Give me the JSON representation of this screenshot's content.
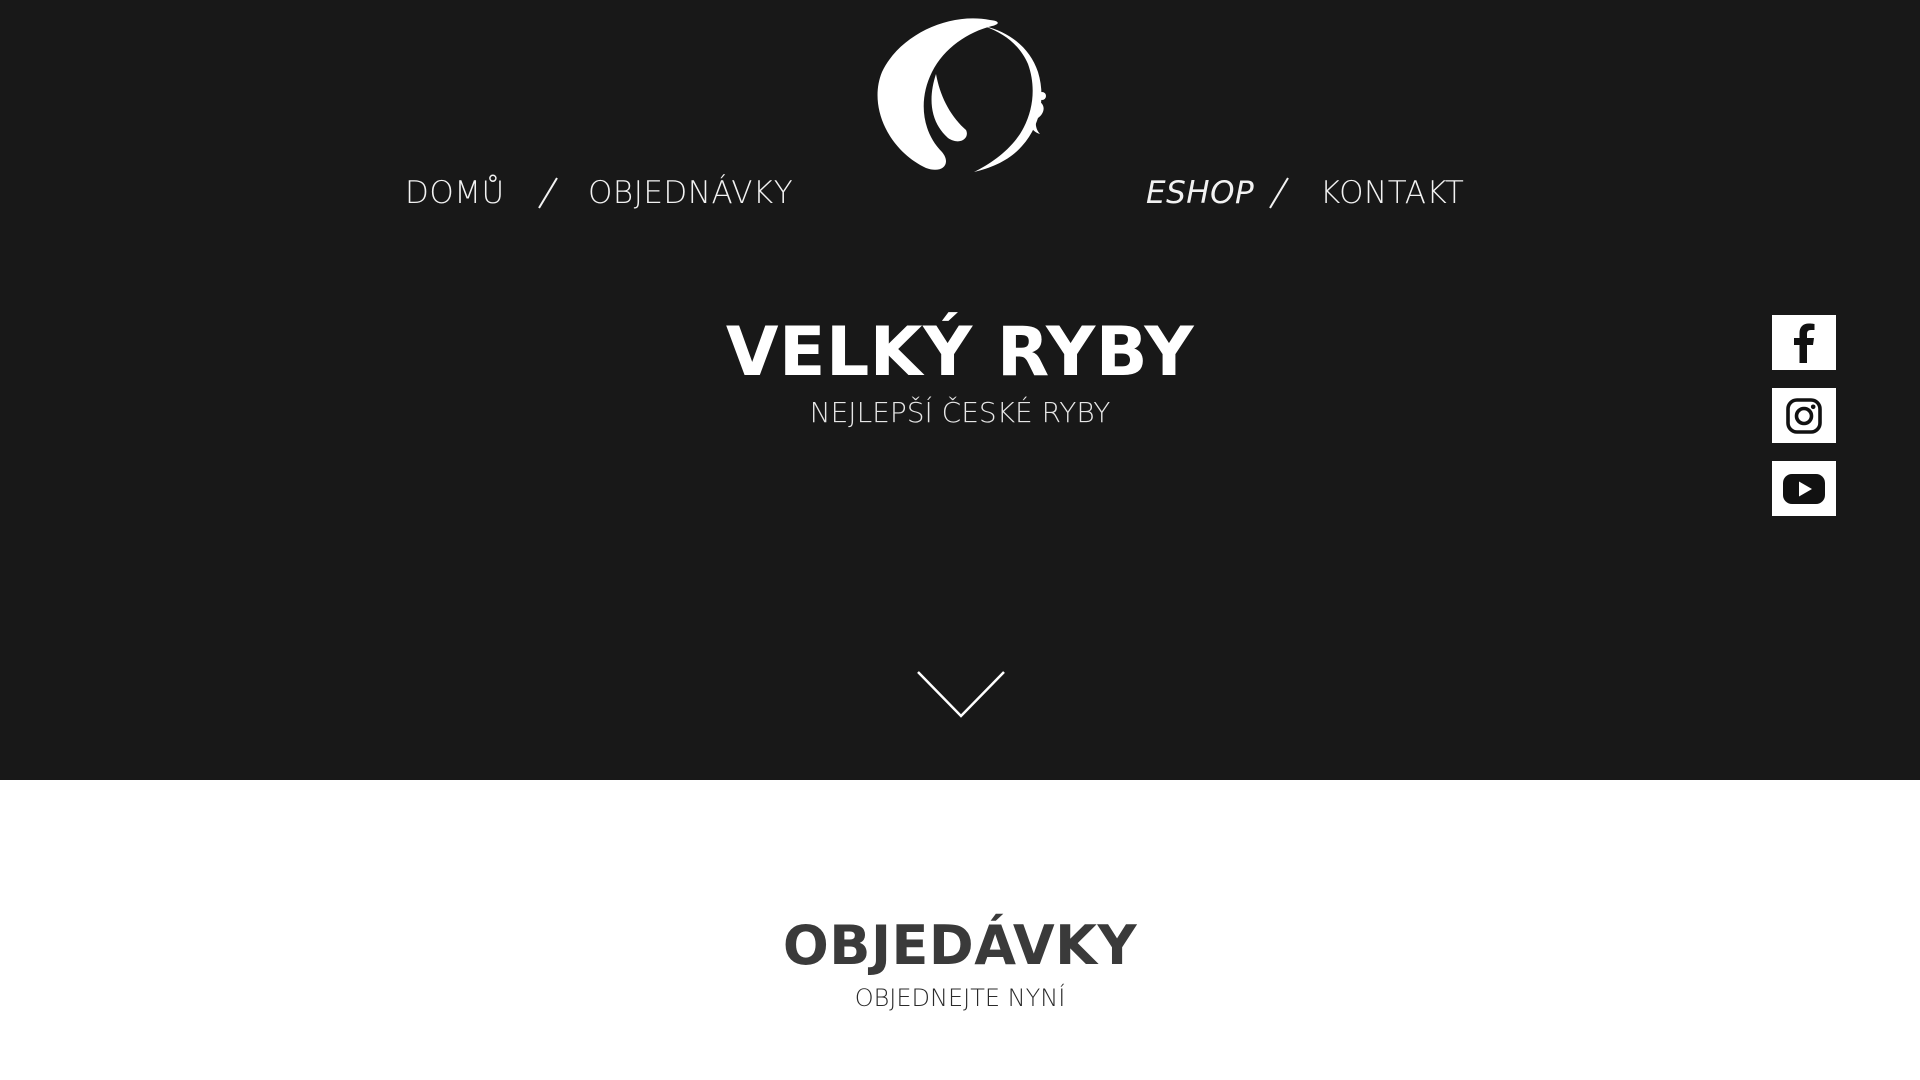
{
  "nav": {
    "home": "DOMŮ",
    "orders": "OBJEDNÁVKY",
    "eshop": "ESHOP",
    "contact": "KONTAKT"
  },
  "hero": {
    "title": "VELKÝ RYBY",
    "subtitle": "NEJLEPŠÍ ČESKÉ RYBY"
  },
  "social": [
    "facebook-icon",
    "instagram-icon",
    "youtube-icon"
  ],
  "section": {
    "title": "OBJEDÁVKY",
    "subtitle": "OBJEDNEJTE NYNÍ"
  },
  "colors": {
    "hero_background": "#181818",
    "page_background": "#ffffff",
    "hero_text": "#ffffff",
    "section_title": "#3a3a3a"
  }
}
